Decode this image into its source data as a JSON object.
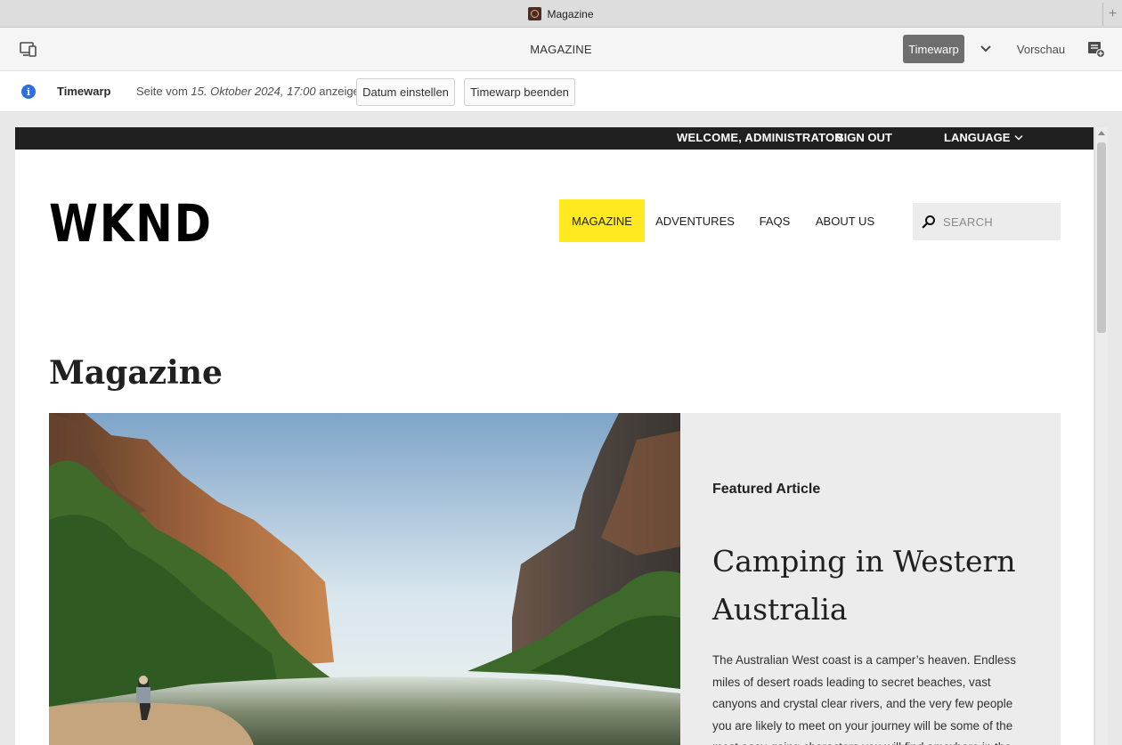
{
  "browser": {
    "tab_title": "Magazine",
    "new_tab_symbol": "+"
  },
  "editor": {
    "page_title": "MAGAZINE",
    "timewarp_button": "Timewarp",
    "preview_button": "Vorschau",
    "icons": [
      "device-emulator-icon",
      "chevron-down-icon",
      "annotation-icon"
    ]
  },
  "timewarp_bar": {
    "label": "Timewarp",
    "text_before": "Seite vom ",
    "date": "15. Oktober 2024, 17:00",
    "text_after": " anzeigen",
    "set_date_button": "Datum einstellen",
    "end_button": "Timewarp beenden"
  },
  "site": {
    "topbar": {
      "welcome": "WELCOME, ADMINISTRATOR",
      "sign_out": "SIGN OUT",
      "language": "LANGUAGE"
    },
    "logo": "WKND",
    "nav": [
      "MAGAZINE",
      "ADVENTURES",
      "FAQS",
      "ABOUT US"
    ],
    "search_placeholder": "SEARCH",
    "accent_color": "#ffea1f",
    "page_heading": "Magazine",
    "featured": {
      "label": "Featured Article",
      "title": "Camping in Western Australia",
      "body": "The Australian West coast is a camper’s heaven. Endless miles of desert roads leading to secret beaches, vast canyons and crystal clear rivers, and the very few people you are likely to meet on your journey will be some of the most easy-going characters you will find anywhere in the world."
    }
  }
}
